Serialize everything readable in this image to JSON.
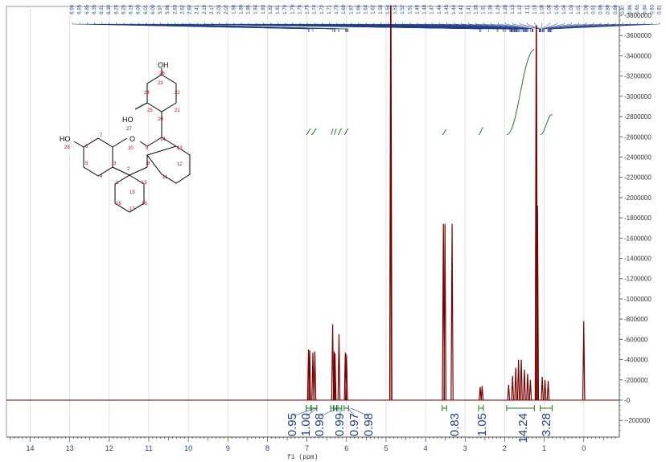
{
  "chart_data": {
    "type": "line",
    "title": "",
    "xlabel": "f1 (ppm)",
    "ylabel": "",
    "xlim": [
      14.6,
      -0.9
    ],
    "ylim": [
      -300000,
      3900000
    ],
    "x_ticks": [
      "14",
      "13",
      "12",
      "11",
      "10",
      "9",
      "8",
      "7",
      "6",
      "5",
      "4",
      "3",
      "2",
      "1",
      "0"
    ],
    "y_ticks": [
      "3800000",
      "3600000",
      "3400000",
      "3200000",
      "3000000",
      "2800000",
      "2600000",
      "2400000",
      "2200000",
      "2000000",
      "1800000",
      "1600000",
      "1400000",
      "1200000",
      "1000000",
      "800000",
      "600000",
      "400000",
      "200000",
      "0",
      "-200000"
    ],
    "grid": true,
    "colors": {
      "spectrum": "#7b0000",
      "integral": "#1e7a1e",
      "labels": "#1f3f8f"
    },
    "peaks": [
      {
        "ppm": 6.96,
        "height": 500000
      },
      {
        "ppm": 6.93,
        "height": 490000
      },
      {
        "ppm": 6.85,
        "height": 470000
      },
      {
        "ppm": 6.8,
        "height": 480000
      },
      {
        "ppm": 6.35,
        "height": 750000
      },
      {
        "ppm": 6.31,
        "height": 480000
      },
      {
        "ppm": 6.29,
        "height": 460000
      },
      {
        "ppm": 6.19,
        "height": 650000
      },
      {
        "ppm": 6.03,
        "height": 470000
      },
      {
        "ppm": 6.0,
        "height": 450000
      },
      {
        "ppm": 4.88,
        "height": 3900000
      },
      {
        "ppm": 3.55,
        "height": 1740000
      },
      {
        "ppm": 3.51,
        "height": 1740000
      },
      {
        "ppm": 3.33,
        "height": 1740000
      },
      {
        "ppm": 2.62,
        "height": 130000
      },
      {
        "ppm": 2.57,
        "height": 140000
      },
      {
        "ppm": 1.9,
        "height": 150000
      },
      {
        "ppm": 1.8,
        "height": 240000
      },
      {
        "ppm": 1.72,
        "height": 320000
      },
      {
        "ppm": 1.65,
        "height": 400000
      },
      {
        "ppm": 1.58,
        "height": 400000
      },
      {
        "ppm": 1.5,
        "height": 300000
      },
      {
        "ppm": 1.42,
        "height": 260000
      },
      {
        "ppm": 1.35,
        "height": 200000
      },
      {
        "ppm": 1.2,
        "height": 3700000
      },
      {
        "ppm": 1.17,
        "height": 1920000
      },
      {
        "ppm": 1.05,
        "height": 230000
      },
      {
        "ppm": 0.98,
        "height": 200000
      },
      {
        "ppm": 0.9,
        "height": 190000
      },
      {
        "ppm": 0.0,
        "height": 780000
      }
    ],
    "peak_labels": [
      "6.96",
      "6.95",
      "6.85",
      "6.35",
      "6.31",
      "6.30",
      "6.29",
      "6.20",
      "6.19",
      "6.03",
      "6.01",
      "6.00",
      "5.97",
      "5.96",
      "2.63",
      "2.62",
      "2.60",
      "2.41",
      "2.19",
      "2.17",
      "2.03",
      "2.02",
      "1.98",
      "1.88",
      "1.86",
      "1.84",
      "1.83",
      "1.82",
      "1.81",
      "1.79",
      "1.78",
      "1.76",
      "1.75",
      "1.74",
      "1.72",
      "1.71",
      "1.70",
      "1.69",
      "1.67",
      "1.66",
      "1.64",
      "1.62",
      "1.58",
      "1.54",
      "1.53",
      "1.52",
      "1.51",
      "1.49",
      "1.48",
      "1.47",
      "1.46",
      "1.45",
      "1.44",
      "1.42",
      "1.41",
      "1.35",
      "1.31",
      "1.30",
      "1.29",
      "1.28",
      "1.13",
      "1.12",
      "1.11",
      "1.10",
      "1.09",
      "1.08",
      "1.05",
      "1.04",
      "1.03",
      "1.01",
      "1.00",
      "0.91",
      "0.90",
      "0.89",
      "0.88",
      "0.87",
      "0.86",
      "0.85",
      "0.84",
      "0.83",
      "0.81"
    ],
    "integrals": [
      {
        "value": "0.95",
        "from": 7.02,
        "to": 6.9
      },
      {
        "value": "1.00",
        "from": 6.89,
        "to": 6.75
      },
      {
        "value": "0.98",
        "from": 6.4,
        "to": 6.33
      },
      {
        "value": "0.99",
        "from": 6.32,
        "to": 6.25
      },
      {
        "value": "0.97",
        "from": 6.22,
        "to": 6.12
      },
      {
        "value": "0.98",
        "from": 6.06,
        "to": 5.95
      },
      {
        "value": "0.83",
        "from": 3.58,
        "to": 3.47
      },
      {
        "value": "1.05",
        "from": 2.66,
        "to": 2.54
      },
      {
        "value": "14.24",
        "from": 1.95,
        "to": 1.25
      },
      {
        "value": "3.28",
        "from": 1.1,
        "to": 0.8
      }
    ],
    "integral_curves": [
      {
        "from": 7.02,
        "to": 6.9,
        "base": 2620000,
        "rise": 60000
      },
      {
        "from": 6.89,
        "to": 6.75,
        "base": 2620000,
        "rise": 60000
      },
      {
        "from": 6.4,
        "to": 6.33,
        "base": 2620000,
        "rise": 60000
      },
      {
        "from": 6.32,
        "to": 6.25,
        "base": 2620000,
        "rise": 60000
      },
      {
        "from": 6.22,
        "to": 6.12,
        "base": 2620000,
        "rise": 60000
      },
      {
        "from": 6.06,
        "to": 5.95,
        "base": 2620000,
        "rise": 60000
      },
      {
        "from": 3.58,
        "to": 3.47,
        "base": 2620000,
        "rise": 50000
      },
      {
        "from": 2.66,
        "to": 2.54,
        "base": 2620000,
        "rise": 70000
      },
      {
        "from": 1.95,
        "to": 1.25,
        "base": 2620000,
        "rise": 840000
      },
      {
        "from": 1.1,
        "to": 0.8,
        "base": 2620000,
        "rise": 200000
      }
    ],
    "structure": {
      "labels": {
        "oh_top": "OH",
        "oh_mid": "HO",
        "oh_left": "HO",
        "ring_o": "O",
        "num_26": "26",
        "num_27": "27",
        "num_28": "28",
        "num_10": "10"
      },
      "atom_numbers": [
        "23",
        "24",
        "22",
        "25",
        "21",
        "20",
        "14",
        "13",
        "12",
        "11",
        "9",
        "8",
        "7",
        "6",
        "5",
        "4",
        "3",
        "2",
        "1",
        "15",
        "16",
        "17",
        "18",
        "19"
      ]
    }
  }
}
